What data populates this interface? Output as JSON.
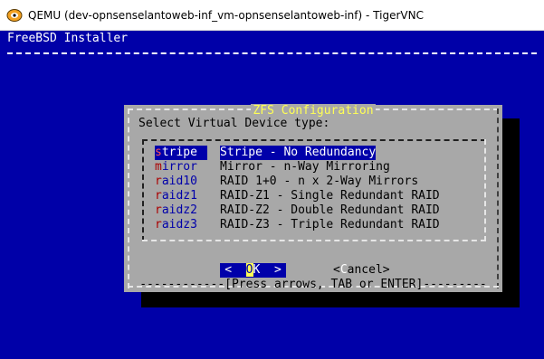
{
  "window": {
    "title": "QEMU (dev-opnsenselantoweb-inf_vm-opnsenselantoweb-inf) - TigerVNC",
    "icon": "qemu-app-icon"
  },
  "screen": {
    "header": "FreeBSD Installer",
    "colors": {
      "background": "#0000a8",
      "dialog": "#a8a8a8",
      "title": "#ffff55",
      "selection": "#0000aa"
    }
  },
  "dialog": {
    "title": "ZFS Configuration",
    "prompt": "Select Virtual Device type:",
    "options": [
      {
        "hot": "s",
        "rest": "tripe",
        "desc": "Stripe - No Redundancy",
        "selected": true
      },
      {
        "hot": "m",
        "rest": "irror",
        "desc": "Mirror - n-Way Mirroring",
        "selected": false
      },
      {
        "hot": "r",
        "rest": "aid10",
        "desc": "RAID 1+0 - n x 2-Way Mirrors",
        "selected": false
      },
      {
        "hot": "r",
        "rest": "aidz1",
        "desc": "RAID-Z1 - Single Redundant RAID",
        "selected": false
      },
      {
        "hot": "r",
        "rest": "aidz2",
        "desc": "RAID-Z2 - Double Redundant RAID",
        "selected": false
      },
      {
        "hot": "r",
        "rest": "aidz3",
        "desc": "RAID-Z3 - Triple Redundant RAID",
        "selected": false
      }
    ],
    "ok": {
      "pre": "<  ",
      "hot": "O",
      "rest": "K  >"
    },
    "cancel": {
      "pre": "<",
      "hot": "C",
      "rest": "ancel>"
    },
    "hint": "[Press arrows, TAB or ENTER]"
  }
}
